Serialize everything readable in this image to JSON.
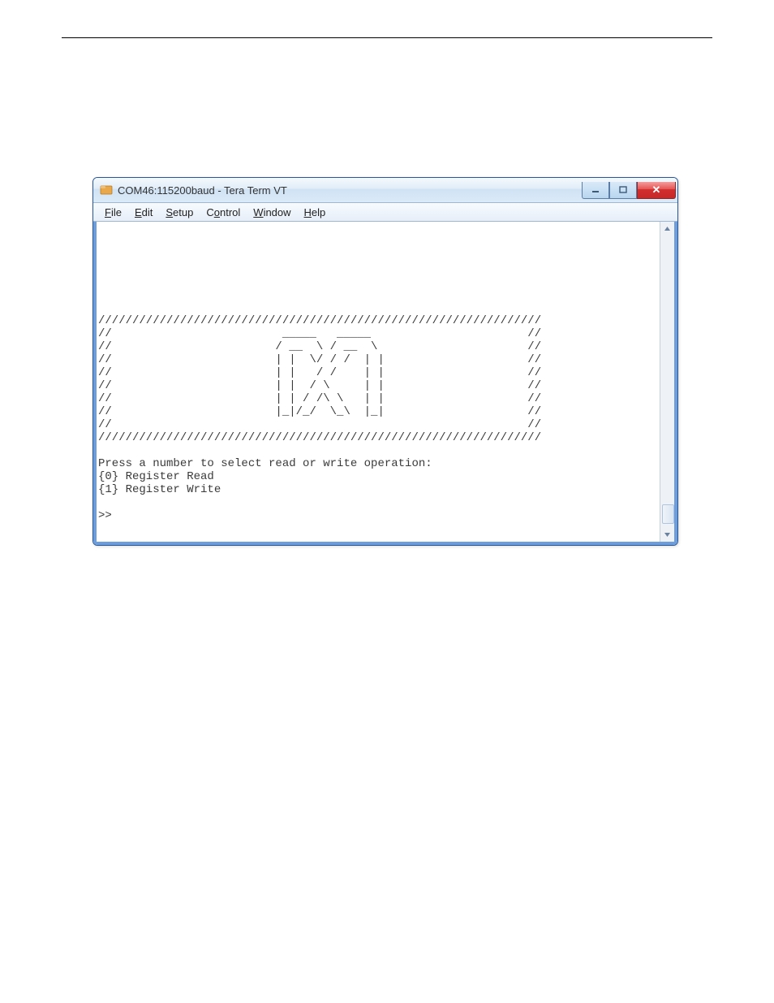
{
  "window": {
    "title": "COM46:115200baud - Tera Term VT"
  },
  "menu": {
    "file": {
      "u": "F",
      "rest": "ile"
    },
    "edit": {
      "u": "E",
      "rest": "dit"
    },
    "setup": {
      "u": "S",
      "rest": "etup"
    },
    "control": {
      "pre": "C",
      "u": "o",
      "rest": "ntrol"
    },
    "window": {
      "u": "W",
      "rest": "indow"
    },
    "help": {
      "u": "H",
      "rest": "elp"
    }
  },
  "terminal": {
    "content": "\n\n\n\n\n\n\n/////////////////////////////////////////////////////////////////\n//                         _____   _____                       //\n//                        / __  \\ / __  \\                      //\n//                        | |  \\/ / /  | |                     //\n//                        | |   / /    | |                     //\n//                        | |  / \\     | |                     //\n//                        | | / /\\ \\   | |                     //\n//                        |_|/_/  \\_\\  |_|                     //\n//                                                             //\n/////////////////////////////////////////////////////////////////\n\nPress a number to select read or write operation:\n{0} Register Read\n{1} Register Write\n\n>>"
  }
}
